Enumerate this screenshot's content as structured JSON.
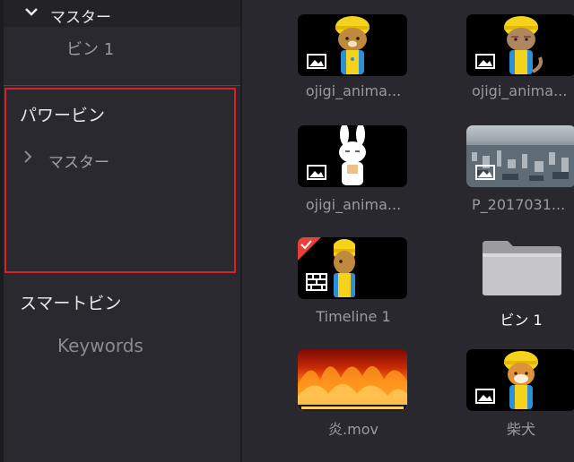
{
  "sidebar": {
    "master_section": {
      "label": "マスター",
      "child": "ビン 1"
    },
    "power_bin": {
      "title": "パワービン",
      "items": [
        {
          "label": "マスター"
        }
      ]
    },
    "smart_bin": {
      "title": "スマートビン",
      "items": [
        {
          "label": "Keywords"
        }
      ]
    }
  },
  "media_pool": {
    "clips": [
      {
        "name": "ojigi_anima...",
        "type": "image",
        "subject": "helmet-bear"
      },
      {
        "name": "ojigi_anima...",
        "type": "image",
        "subject": "helmet-cat"
      },
      {
        "name": "ojigi_anima...",
        "type": "image",
        "subject": "rabbit"
      },
      {
        "name": "P_2017031...",
        "type": "image",
        "subject": "city-aerial"
      },
      {
        "name": "Timeline 1",
        "type": "timeline",
        "subject": "helmet-bear"
      },
      {
        "name": "ビン 1",
        "type": "folder"
      },
      {
        "name": "炎.mov",
        "type": "video",
        "subject": "fire"
      },
      {
        "name": "柴犬",
        "type": "image",
        "subject": "helmet-dog"
      }
    ]
  },
  "colors": {
    "highlight_border": "#d9202a",
    "accent": "#e8403a",
    "helmet": "#f5d21b"
  }
}
